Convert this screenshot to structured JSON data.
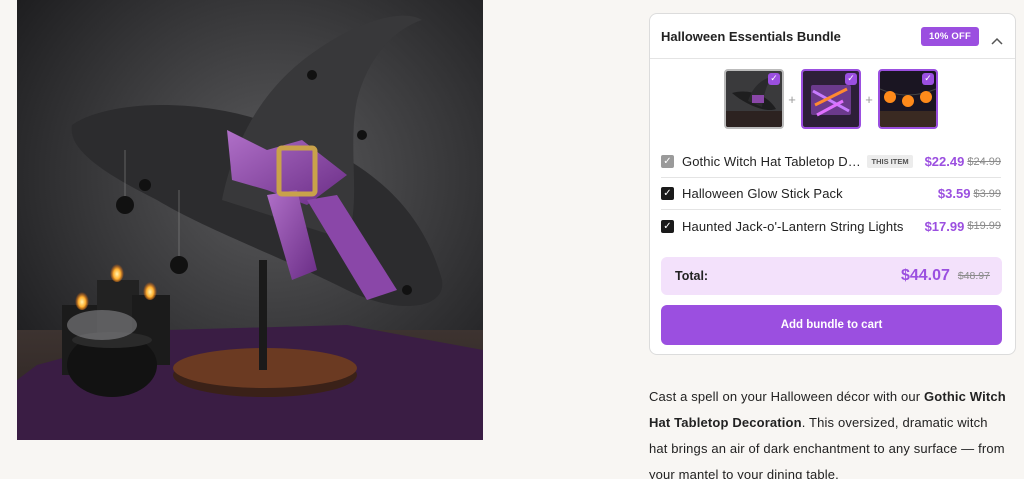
{
  "product_image": {
    "alt": "",
    "icon": "witch-hat-product-photo"
  },
  "bundle": {
    "title": "Halloween Essentials Bundle",
    "discount_badge": "10% OFF",
    "collapse_icon": "chevron-up-icon",
    "accent_color": "#9b4fe0",
    "thumbnails": [
      {
        "name": "witch-hat",
        "selected": false
      },
      {
        "name": "glow-sticks",
        "selected": true
      },
      {
        "name": "jack-o-lantern-lights",
        "selected": true
      }
    ],
    "plus_symbol": "+",
    "items": [
      {
        "name": "Gothic Witch Hat Tabletop Decoration",
        "badge": "THIS ITEM",
        "price": "$22.49",
        "original_price": "$24.99",
        "checked": true,
        "disabled": true
      },
      {
        "name": "Halloween Glow Stick Pack",
        "badge": "",
        "price": "$3.59",
        "original_price": "$3.99",
        "checked": true,
        "disabled": false
      },
      {
        "name": "Haunted Jack-o'-Lantern String Lights",
        "badge": "",
        "price": "$17.99",
        "original_price": "$19.99",
        "checked": true,
        "disabled": false
      }
    ],
    "total_label": "Total:",
    "total_price": "$44.07",
    "total_original": "$48.97",
    "cta_label": "Add bundle to cart"
  },
  "description": {
    "intro": "Cast a spell on your Halloween décor with our ",
    "product_name": "Gothic Witch Hat Tabletop Decoration",
    "rest": ". This oversized, dramatic witch hat brings an air of dark enchantment to any surface — from your mantel to your dining table."
  }
}
